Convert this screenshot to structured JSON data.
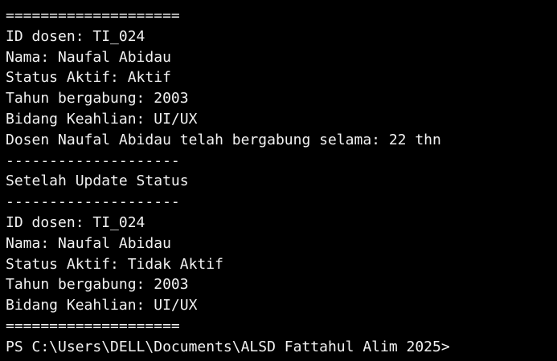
{
  "terminal": {
    "lines": [
      "====================",
      "ID dosen: TI_024",
      "Nama: Naufal Abidau",
      "Status Aktif: Aktif",
      "Tahun bergabung: 2003",
      "Bidang Keahlian: UI/UX",
      "Dosen Naufal Abidau telah bergabung selama: 22 thn",
      "--------------------",
      "Setelah Update Status",
      "--------------------",
      "ID dosen: TI_024",
      "Nama: Naufal Abidau",
      "Status Aktif: Tidak Aktif",
      "Tahun bergabung: 2003",
      "Bidang Keahlian: UI/UX",
      "===================="
    ],
    "prompt": "PS C:\\Users\\DELL\\Documents\\ALSD Fattahul Alim 2025>",
    "colors": {
      "background": "#000000",
      "foreground": "#f2f2f2"
    }
  }
}
